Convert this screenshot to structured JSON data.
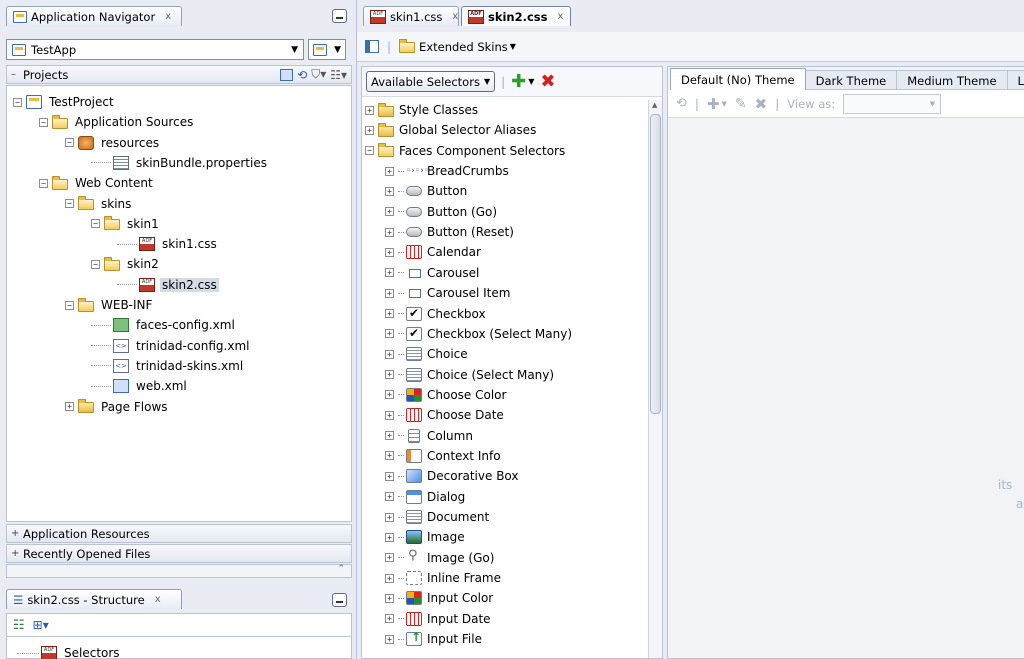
{
  "navigator": {
    "tab_label": "Application Navigator",
    "app_name": "TestApp",
    "projects_label": "Projects",
    "app_resources_label": "Application Resources",
    "recent_files_label": "Recently Opened Files",
    "tree": [
      {
        "label": "TestProject",
        "depth": 0,
        "icon": "project-icon",
        "expander": "minus"
      },
      {
        "label": "Application Sources",
        "depth": 1,
        "icon": "folder-open-icon",
        "expander": "minus"
      },
      {
        "label": "resources",
        "depth": 2,
        "icon": "jar-icon",
        "expander": "minus"
      },
      {
        "label": "skinBundle.properties",
        "depth": 3,
        "icon": "properties-file-icon",
        "expander": "none"
      },
      {
        "label": "Web Content",
        "depth": 1,
        "icon": "folder-open-icon",
        "expander": "minus"
      },
      {
        "label": "skins",
        "depth": 2,
        "icon": "folder-open-icon",
        "expander": "minus"
      },
      {
        "label": "skin1",
        "depth": 3,
        "icon": "folder-open-icon",
        "expander": "minus"
      },
      {
        "label": "skin1.css",
        "depth": 4,
        "icon": "css-file-icon",
        "expander": "none"
      },
      {
        "label": "skin2",
        "depth": 3,
        "icon": "folder-open-icon",
        "expander": "minus"
      },
      {
        "label": "skin2.css",
        "depth": 4,
        "icon": "css-file-icon",
        "expander": "none",
        "selected": true
      },
      {
        "label": "WEB-INF",
        "depth": 2,
        "icon": "folder-open-icon",
        "expander": "minus"
      },
      {
        "label": "faces-config.xml",
        "depth": 3,
        "icon": "faces-config-icon",
        "expander": "none"
      },
      {
        "label": "trinidad-config.xml",
        "depth": 3,
        "icon": "xml-file-icon",
        "expander": "none"
      },
      {
        "label": "trinidad-skins.xml",
        "depth": 3,
        "icon": "xml-file-icon",
        "expander": "none"
      },
      {
        "label": "web.xml",
        "depth": 3,
        "icon": "web-xml-icon",
        "expander": "none"
      },
      {
        "label": "Page Flows",
        "depth": 2,
        "icon": "folder-icon",
        "expander": "plus"
      }
    ]
  },
  "structure": {
    "tab_label": "skin2.css - Structure",
    "root_label": "Selectors"
  },
  "editor": {
    "tabs": [
      {
        "label": "skin1.css",
        "active": false
      },
      {
        "label": "skin2.css",
        "active": true
      }
    ],
    "extended_skins_label": "Extended Skins",
    "selectors_dropdown": "Available Selectors",
    "theme_tabs": [
      "Default (No) Theme",
      "Dark Theme",
      "Medium Theme",
      "L"
    ],
    "view_as_label": "View as:",
    "preview_partial_text": [
      "its",
      "a"
    ],
    "selector_tree": [
      {
        "label": "Style Classes",
        "depth": 0,
        "icon": "folder-icon",
        "expander": "plus"
      },
      {
        "label": "Global Selector Aliases",
        "depth": 0,
        "icon": "folder-icon",
        "expander": "plus"
      },
      {
        "label": "Faces Component Selectors",
        "depth": 0,
        "icon": "folder-open-icon",
        "expander": "minus"
      },
      {
        "label": "BreadCrumbs",
        "depth": 1,
        "icon": "breadcrumbs-icon",
        "expander": "plus"
      },
      {
        "label": "Button",
        "depth": 1,
        "icon": "button-icon",
        "expander": "plus"
      },
      {
        "label": "Button (Go)",
        "depth": 1,
        "icon": "button-icon",
        "expander": "plus"
      },
      {
        "label": "Button (Reset)",
        "depth": 1,
        "icon": "button-reset-icon",
        "expander": "plus"
      },
      {
        "label": "Calendar",
        "depth": 1,
        "icon": "calendar-icon",
        "expander": "plus"
      },
      {
        "label": "Carousel",
        "depth": 1,
        "icon": "carousel-icon",
        "expander": "plus"
      },
      {
        "label": "Carousel Item",
        "depth": 1,
        "icon": "carousel-item-icon",
        "expander": "plus"
      },
      {
        "label": "Checkbox",
        "depth": 1,
        "icon": "checkbox-icon",
        "expander": "plus"
      },
      {
        "label": "Checkbox (Select Many)",
        "depth": 1,
        "icon": "checkbox-icon",
        "expander": "plus"
      },
      {
        "label": "Choice",
        "depth": 1,
        "icon": "choice-icon",
        "expander": "plus"
      },
      {
        "label": "Choice (Select Many)",
        "depth": 1,
        "icon": "choice-icon",
        "expander": "plus"
      },
      {
        "label": "Choose Color",
        "depth": 1,
        "icon": "color-grid-icon",
        "expander": "plus"
      },
      {
        "label": "Choose Date",
        "depth": 1,
        "icon": "calendar-icon",
        "expander": "plus"
      },
      {
        "label": "Column",
        "depth": 1,
        "icon": "column-icon",
        "expander": "plus"
      },
      {
        "label": "Context Info",
        "depth": 1,
        "icon": "context-info-icon",
        "expander": "plus"
      },
      {
        "label": "Decorative Box",
        "depth": 1,
        "icon": "decorative-box-icon",
        "expander": "plus"
      },
      {
        "label": "Dialog",
        "depth": 1,
        "icon": "dialog-icon",
        "expander": "plus"
      },
      {
        "label": "Document",
        "depth": 1,
        "icon": "document-icon",
        "expander": "plus"
      },
      {
        "label": "Image",
        "depth": 1,
        "icon": "image-icon",
        "expander": "plus"
      },
      {
        "label": "Image (Go)",
        "depth": 1,
        "icon": "image-link-icon",
        "expander": "plus"
      },
      {
        "label": "Inline Frame",
        "depth": 1,
        "icon": "inline-frame-icon",
        "expander": "plus"
      },
      {
        "label": "Input Color",
        "depth": 1,
        "icon": "color-grid-icon",
        "expander": "plus"
      },
      {
        "label": "Input Date",
        "depth": 1,
        "icon": "calendar-icon",
        "expander": "plus"
      },
      {
        "label": "Input File",
        "depth": 1,
        "icon": "input-file-icon",
        "expander": "plus"
      }
    ]
  }
}
